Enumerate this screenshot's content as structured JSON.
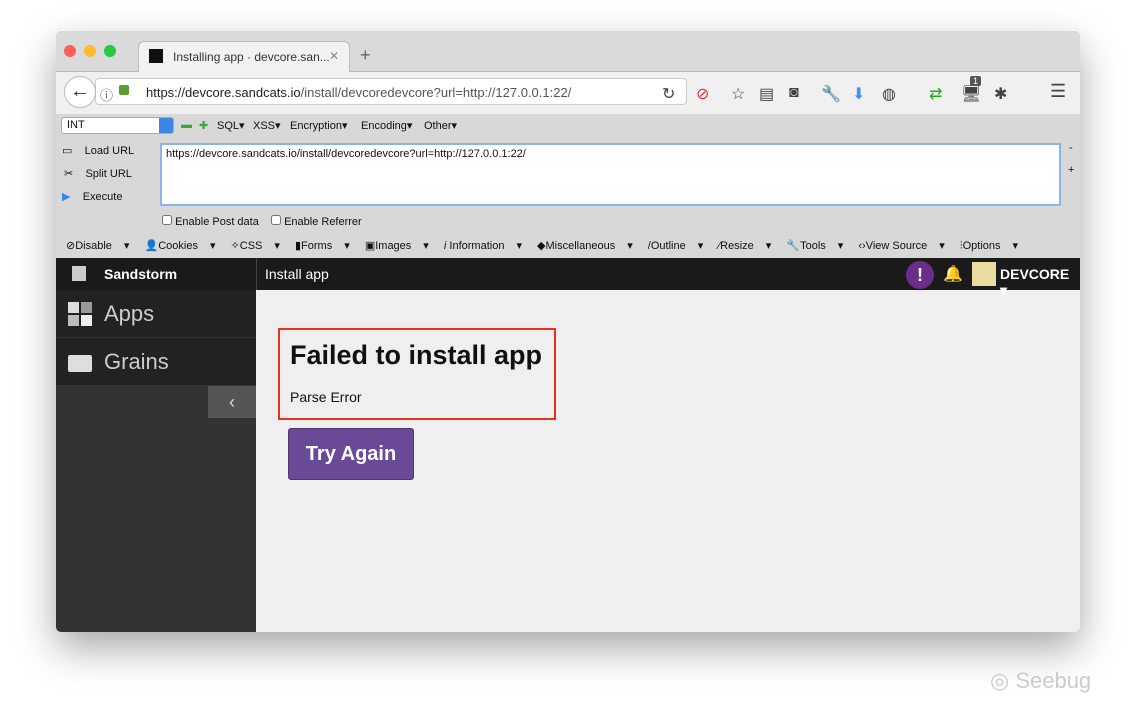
{
  "browser": {
    "tab_title": "Installing app · devcore.san...",
    "url_host": "https://devcore.sandcats.io",
    "url_path": "/install/devcoredevcore?url=http://127.0.0.1:22/",
    "badge": "1"
  },
  "hackbar": {
    "select": "INT",
    "menus": [
      "SQL",
      "XSS",
      "Encryption",
      "Encoding",
      "Other"
    ],
    "load_url": "Load URL",
    "split_url": "Split URL",
    "execute": "Execute",
    "textarea": "https://devcore.sandcats.io/install/devcoredevcore?url=http://127.0.0.1:22/",
    "enable_post": "Enable Post data",
    "enable_referrer": "Enable Referrer"
  },
  "webdev": [
    "Disable",
    "Cookies",
    "CSS",
    "Forms",
    "Images",
    "Information",
    "Miscellaneous",
    "Outline",
    "Resize",
    "Tools",
    "View Source",
    "Options"
  ],
  "app": {
    "brand": "Sandstorm",
    "page_title": "Install app",
    "user": "DEVCORE",
    "sidebar": [
      "Apps",
      "Grains"
    ],
    "error_title": "Failed to install app",
    "error_msg": "Parse Error",
    "retry": "Try Again"
  },
  "watermark": "Seebug"
}
